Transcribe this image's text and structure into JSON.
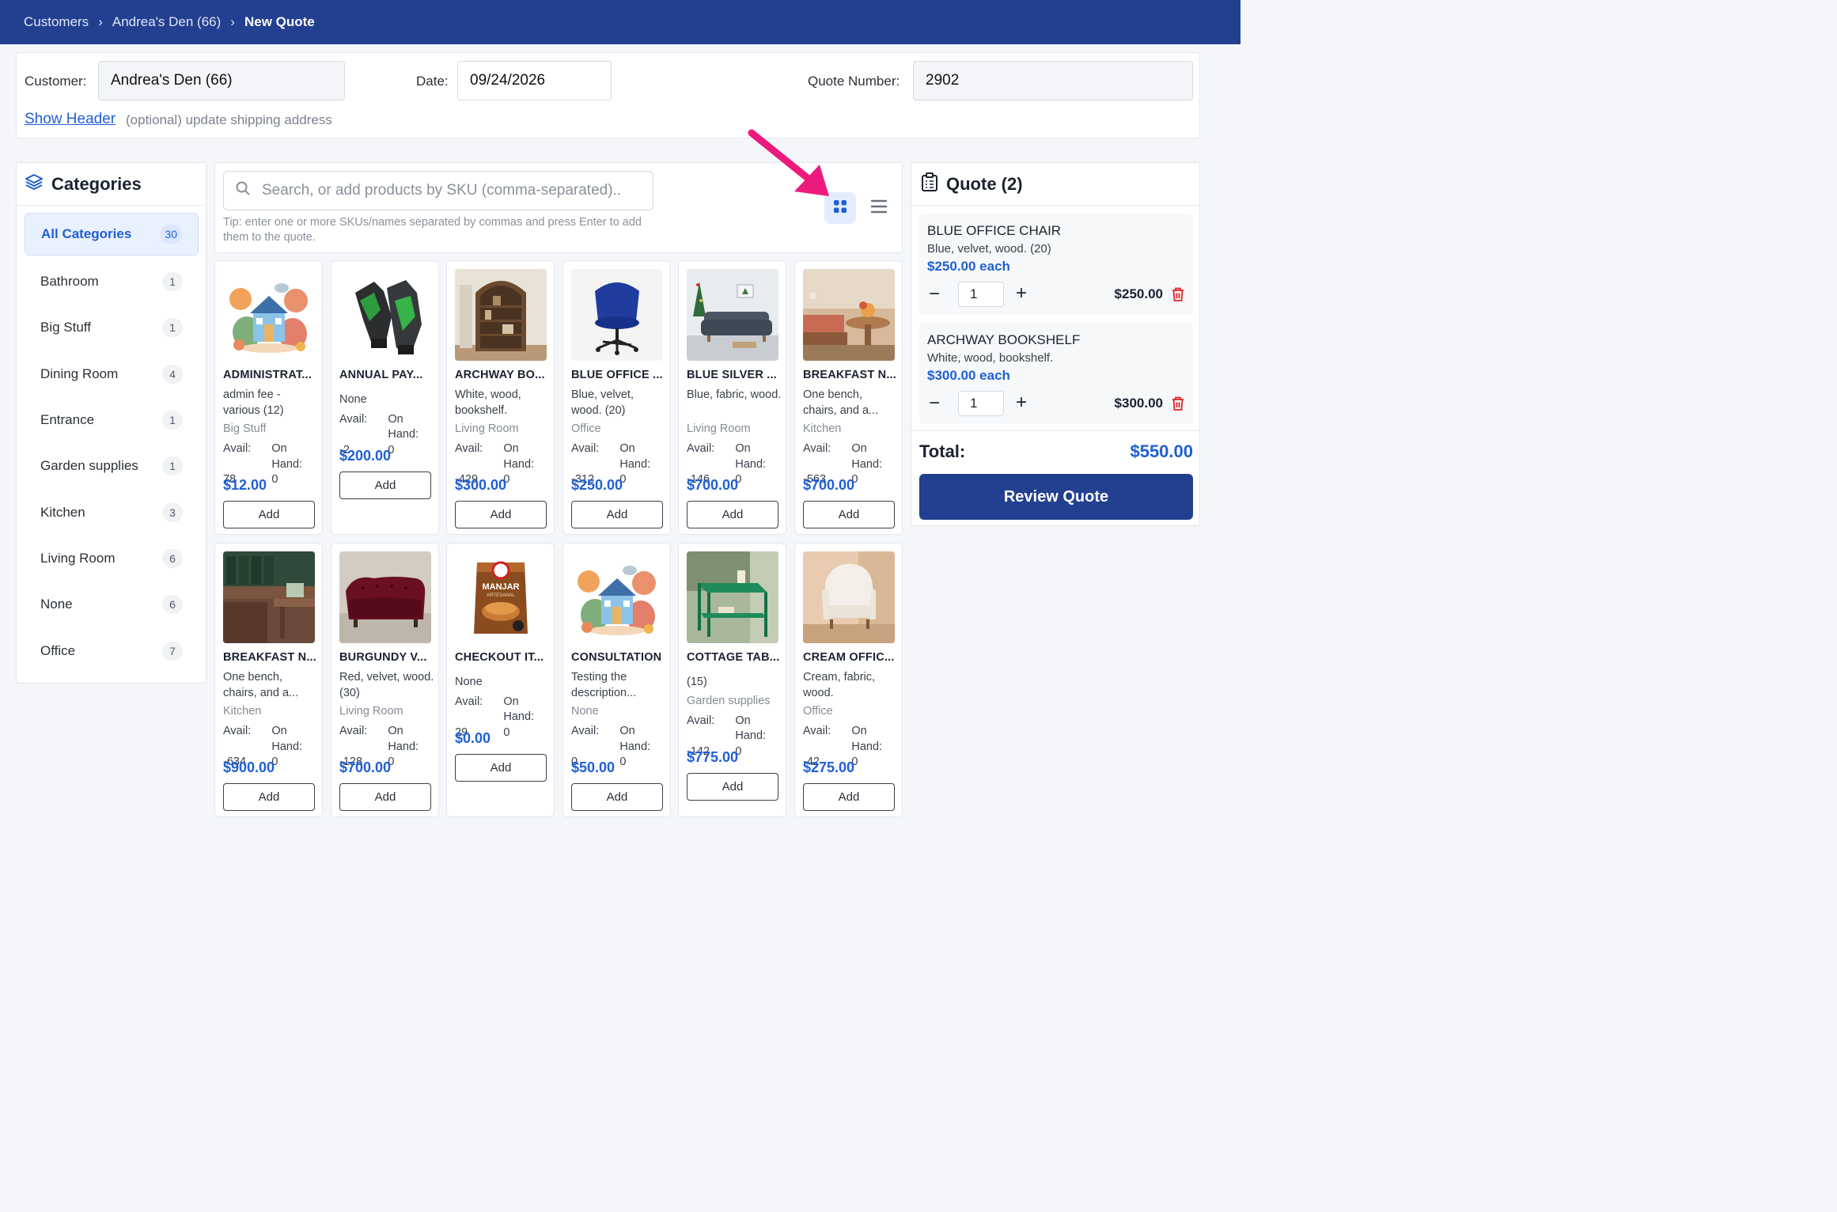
{
  "breadcrumb": {
    "items": [
      "Customers",
      "Andrea's Den (66)"
    ],
    "current": "New Quote",
    "separator": "›"
  },
  "header": {
    "customer_label": "Customer:",
    "customer_value": "Andrea's Den (66)",
    "date_label": "Date:",
    "date_value": "09/24/2026",
    "quote_number_label": "Quote Number:",
    "quote_number_value": "2902",
    "show_header_link": "Show Header",
    "show_header_hint": "(optional) update shipping address"
  },
  "categories": {
    "title": "Categories",
    "items": [
      {
        "label": "All Categories",
        "count": "30",
        "active": true
      },
      {
        "label": "Bathroom",
        "count": "1"
      },
      {
        "label": "Big Stuff",
        "count": "1"
      },
      {
        "label": "Dining Room",
        "count": "4"
      },
      {
        "label": "Entrance",
        "count": "1"
      },
      {
        "label": "Garden supplies",
        "count": "1"
      },
      {
        "label": "Kitchen",
        "count": "3"
      },
      {
        "label": "Living Room",
        "count": "6"
      },
      {
        "label": "None",
        "count": "6"
      },
      {
        "label": "Office",
        "count": "7"
      }
    ]
  },
  "search": {
    "placeholder": "Search, or add products by SKU (comma-separated)..",
    "tip": "Tip: enter one or more SKUs/names separated by commas and press Enter to add them to the quote.",
    "view_grid_icon": "grid-icon",
    "view_list_icon": "list-icon"
  },
  "products": [
    {
      "name": "ADMINISTRAT...",
      "desc": "admin fee - various (12)",
      "category": "Big Stuff",
      "avail_label": "Avail:",
      "avail": "78",
      "onhand_label": "On Hand:",
      "onhand": "0",
      "price": "$12.00",
      "add": "Add",
      "image": "house-illustration"
    },
    {
      "name": "ANNUAL PAY...",
      "desc": "None",
      "category": "",
      "avail_label": "Avail:",
      "avail": "-2",
      "onhand_label": "On Hand:",
      "onhand": "0",
      "price": "$200.00",
      "add": "Add",
      "image": "gloves"
    },
    {
      "name": "ARCHWAY BO...",
      "desc": "White, wood, bookshelf.",
      "category": "Living Room",
      "avail_label": "Avail:",
      "avail": "-429",
      "onhand_label": "On Hand:",
      "onhand": "0",
      "price": "$300.00",
      "add": "Add",
      "image": "bookshelf"
    },
    {
      "name": "BLUE OFFICE ...",
      "desc": "Blue, velvet, wood. (20)",
      "category": "Office",
      "avail_label": "Avail:",
      "avail": "-312",
      "onhand_label": "On Hand:",
      "onhand": "0",
      "price": "$250.00",
      "add": "Add",
      "image": "blue-chair"
    },
    {
      "name": "BLUE SILVER ...",
      "desc": "Blue, fabric, wood.",
      "category": "Living Room",
      "avail_label": "Avail:",
      "avail": "-146",
      "onhand_label": "On Hand:",
      "onhand": "0",
      "price": "$700.00",
      "add": "Add",
      "image": "sofa-room"
    },
    {
      "name": "BREAKFAST N...",
      "desc": "One bench, chairs, and a...",
      "category": "Kitchen",
      "avail_label": "Avail:",
      "avail": "-563",
      "onhand_label": "On Hand:",
      "onhand": "0",
      "price": "$700.00",
      "add": "Add",
      "image": "breakfast-nook"
    },
    {
      "name": "BREAKFAST N...",
      "desc": "One bench, chairs, and a...",
      "category": "Kitchen",
      "avail_label": "Avail:",
      "avail": "-634",
      "onhand_label": "On Hand:",
      "onhand": "0",
      "price": "$900.00",
      "add": "Add",
      "image": "green-bench"
    },
    {
      "name": "BURGUNDY V...",
      "desc": "Red, velvet, wood. (30)",
      "category": "Living Room",
      "avail_label": "Avail:",
      "avail": "-128",
      "onhand_label": "On Hand:",
      "onhand": "0",
      "price": "$700.00",
      "add": "Add",
      "image": "burgundy-sofa"
    },
    {
      "name": "CHECKOUT IT...",
      "desc": "None",
      "category": "",
      "avail_label": "Avail:",
      "avail": "29",
      "onhand_label": "On Hand:",
      "onhand": "0",
      "price": "$0.00",
      "add": "Add",
      "image": "manjar-package"
    },
    {
      "name": "CONSULTATION",
      "desc": "Testing the description...",
      "category": "None",
      "avail_label": "Avail:",
      "avail": "0",
      "onhand_label": "On Hand:",
      "onhand": "0",
      "price": "$50.00",
      "add": "Add",
      "image": "house-illustration"
    },
    {
      "name": "COTTAGE TAB...",
      "desc": "(15)",
      "category": "Garden supplies",
      "avail_label": "Avail:",
      "avail": "-142",
      "onhand_label": "On Hand:",
      "onhand": "0",
      "price": "$775.00",
      "add": "Add",
      "image": "green-table"
    },
    {
      "name": "CREAM OFFIC...",
      "desc": "Cream, fabric, wood.",
      "category": "Office",
      "avail_label": "Avail:",
      "avail": "-42",
      "onhand_label": "On Hand:",
      "onhand": "0",
      "price": "$275.00",
      "add": "Add",
      "image": "cream-chair"
    }
  ],
  "quote": {
    "title": "Quote (2)",
    "items": [
      {
        "name": "BLUE OFFICE CHAIR",
        "desc": "Blue, velvet, wood. (20)",
        "each": "$250.00 each",
        "qty": "1",
        "total": "$250.00"
      },
      {
        "name": "ARCHWAY BOOKSHELF",
        "desc": "White, wood, bookshelf.",
        "each": "$300.00 each",
        "qty": "1",
        "total": "$300.00"
      }
    ],
    "total_label": "Total:",
    "total_value": "$550.00",
    "review_button": "Review Quote",
    "minus": "−",
    "plus": "+"
  },
  "colors": {
    "brand": "#22408f",
    "accent": "#1f5fd6",
    "danger": "#e02424",
    "annotation": "#ec1a7c"
  }
}
